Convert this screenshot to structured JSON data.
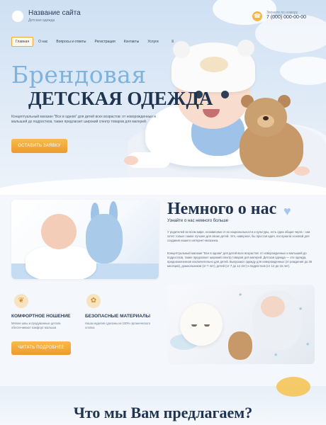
{
  "header": {
    "site_title": "Название сайта",
    "site_subtitle": "Детская одежда",
    "phone_label": "Звоните по номеру",
    "phone_number": "7 (000) 000-00-00"
  },
  "nav": {
    "items": [
      "Главная",
      "О нас",
      "Вопросы и ответы",
      "Регистрация",
      "Контакты",
      "Услуги"
    ],
    "menu_icon": "≡"
  },
  "hero": {
    "title_line1": "Брендовая",
    "title_line2": "ДЕТСКАЯ ОДЕЖДА",
    "description": "Концептуальный магазин \"Все в одном\" для детей всех возрастов: от новорожденных и малышей до подростков, также предлагает широкий спектр товаров для матерей.",
    "button": "ОСТАВИТЬ ЗАЯВКУ"
  },
  "about": {
    "title": "Немного о нас",
    "subtitle": "Узнайте о нас немного больше",
    "paragraph1": "У родителей во всем мире, независимо от их национальности и культуры, есть одна общая черта - они хотят только самое лучшее для своих детей. Это, наверное, бы простая идея, послужила основой для создания нашего интернет-магазина.",
    "paragraph2": "Концептуальный магазин \"Все в одном\" для детей всех возрастов: от новорожденных и малышей до подростков, также предлагает широкий спектр товаров для матерей. Детская одежда — это одежда, предназначенная исключительно для детей. Выпускают одежду для новорожденных (от рождения до 36 месяцев), дошкольников (от 7 лет), детей (от 7 до 12 лет) и подростков (от 12 до 16 лет).",
    "features": [
      {
        "icon": "feather-icon",
        "title": "КОМФОРТНОЕ НОШЕНИЕ",
        "text": "Мягкие швы и продуманные детали обеспечивают комфорт малыша"
      },
      {
        "icon": "cotton-icon",
        "title": "БЕЗОПАСНЫЕ МАТЕРИАЛЫ",
        "text": "Наша изделия сделаны из 100% органического хлопка"
      }
    ],
    "button": "ЧИТАТЬ ПОДРОБНЕЕ"
  },
  "offer": {
    "title": "Что мы Вам предлагаем?"
  },
  "colors": {
    "accent": "#f2a93b",
    "heading": "#1f3450",
    "hero_title": "#7fb2dc"
  }
}
